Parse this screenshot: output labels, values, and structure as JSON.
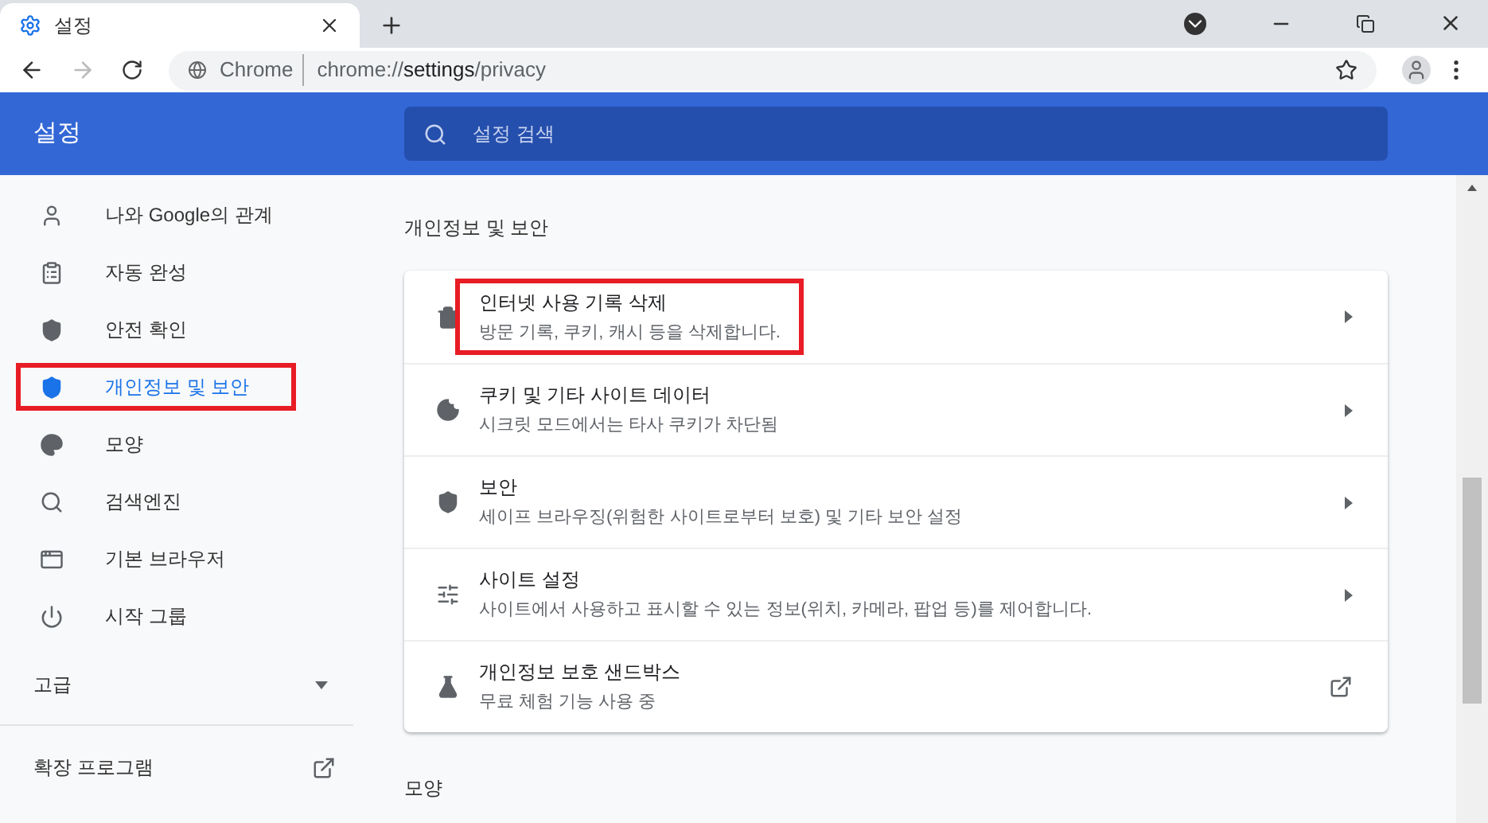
{
  "tab": {
    "title": "설정",
    "selected": true
  },
  "address": {
    "site": "Chrome",
    "url_prefix": "chrome://",
    "url_host": "settings",
    "url_path": "/privacy"
  },
  "header": {
    "title": "설정",
    "search_placeholder": "설정 검색"
  },
  "sidebar": {
    "items": [
      {
        "label": "나와 Google의 관계",
        "selected": false,
        "highlighted": false
      },
      {
        "label": "자동 완성",
        "selected": false,
        "highlighted": false
      },
      {
        "label": "안전 확인",
        "selected": false,
        "highlighted": false
      },
      {
        "label": "개인정보 및 보안",
        "selected": true,
        "highlighted": true
      },
      {
        "label": "모양",
        "selected": false,
        "highlighted": false
      },
      {
        "label": "검색엔진",
        "selected": false,
        "highlighted": false
      },
      {
        "label": "기본 브라우저",
        "selected": false,
        "highlighted": false
      },
      {
        "label": "시작 그룹",
        "selected": false,
        "highlighted": false
      }
    ],
    "advanced": {
      "label": "고급",
      "expanded": false
    },
    "extensions": {
      "label": "확장 프로그램"
    }
  },
  "section": {
    "title": "개인정보 및 보안",
    "rows": [
      {
        "title": "인터넷 사용 기록 삭제",
        "subtitle": "방문 기록, 쿠키, 캐시 등을 삭제합니다.",
        "kind": "submenu",
        "highlighted": true
      },
      {
        "title": "쿠키 및 기타 사이트 데이터",
        "subtitle": "시크릿 모드에서는 타사 쿠키가 차단됨",
        "kind": "submenu",
        "highlighted": false
      },
      {
        "title": "보안",
        "subtitle": "세이프 브라우징(위험한 사이트로부터 보호) 및 기타 보안 설정",
        "kind": "submenu",
        "highlighted": false
      },
      {
        "title": "사이트 설정",
        "subtitle": "사이트에서 사용하고 표시할 수 있는 정보(위치, 카메라, 팝업 등)를 제어합니다.",
        "kind": "submenu",
        "highlighted": false
      },
      {
        "title": "개인정보 보호 샌드박스",
        "subtitle": "무료 체험 기능 사용 중",
        "kind": "external",
        "highlighted": false
      }
    ]
  },
  "next_section": {
    "title": "모양"
  }
}
